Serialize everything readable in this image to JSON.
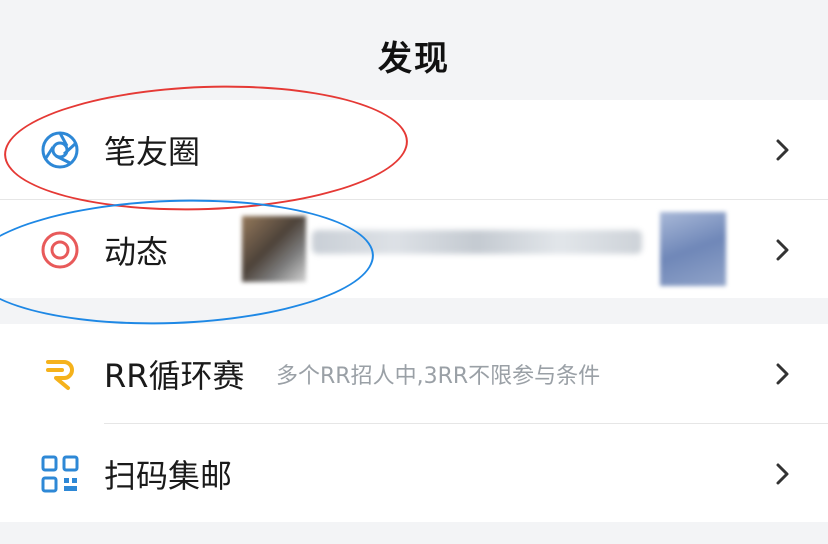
{
  "header": {
    "title": "发现"
  },
  "items": [
    {
      "label": "笔友圈",
      "icon": "aperture-icon"
    },
    {
      "label": "动态",
      "icon": "target-icon"
    },
    {
      "label": "RR循环赛",
      "subtitle": "多个RR招人中,3RR不限参与条件",
      "icon": "rr-logo-icon"
    },
    {
      "label": "扫码集邮",
      "icon": "qr-code-icon"
    }
  ],
  "colors": {
    "background": "#f3f4f6",
    "row_background": "#ffffff",
    "aperture_blue": "#2e88d6",
    "target_red": "#e85a5a",
    "rr_yellow": "#f5b21b",
    "qr_blue": "#2e88d6",
    "annotation_red": "#e53935",
    "annotation_blue": "#1e88e5"
  }
}
